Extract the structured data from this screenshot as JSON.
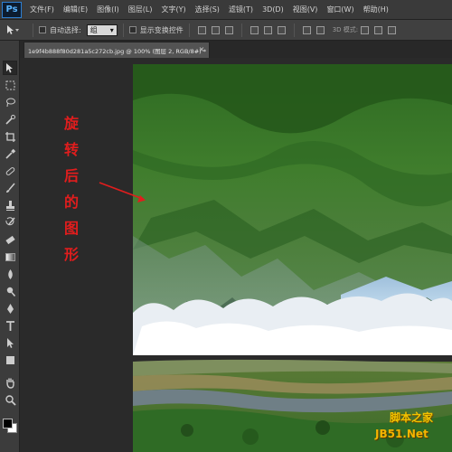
{
  "app": {
    "logo": "Ps"
  },
  "menu": [
    "文件(F)",
    "编辑(E)",
    "图像(I)",
    "图层(L)",
    "文字(Y)",
    "选择(S)",
    "滤镜(T)",
    "3D(D)",
    "视图(V)",
    "窗口(W)",
    "帮助(H)"
  ],
  "options": {
    "auto_select_label": "自动选择:",
    "auto_select_value": "组",
    "show_transform_label": "显示变换控件",
    "mode_3d_label": "3D 模式:"
  },
  "document_tab": {
    "title": "1e9f4b888f80d281a5c272cb.jpg @ 100% (图层 2, RGB/8#) *",
    "close": "×"
  },
  "annotation": {
    "chars": [
      "旋",
      "转",
      "后",
      "的",
      "图",
      "形"
    ]
  },
  "watermark": {
    "top": "脚本之家",
    "bottom": "JB51.Net"
  },
  "colors": {
    "annotation": "#e11d1d",
    "accent": "#2e7fd1",
    "watermark": "#f2c200"
  },
  "tools": [
    "move-tool",
    "marquee-tool",
    "lasso-tool",
    "quick-select-tool",
    "crop-tool",
    "eyedropper-tool",
    "healing-brush-tool",
    "brush-tool",
    "clone-stamp-tool",
    "history-brush-tool",
    "eraser-tool",
    "gradient-tool",
    "blur-tool",
    "dodge-tool",
    "pen-tool",
    "type-tool",
    "path-select-tool",
    "shape-tool",
    "hand-tool",
    "zoom-tool"
  ]
}
